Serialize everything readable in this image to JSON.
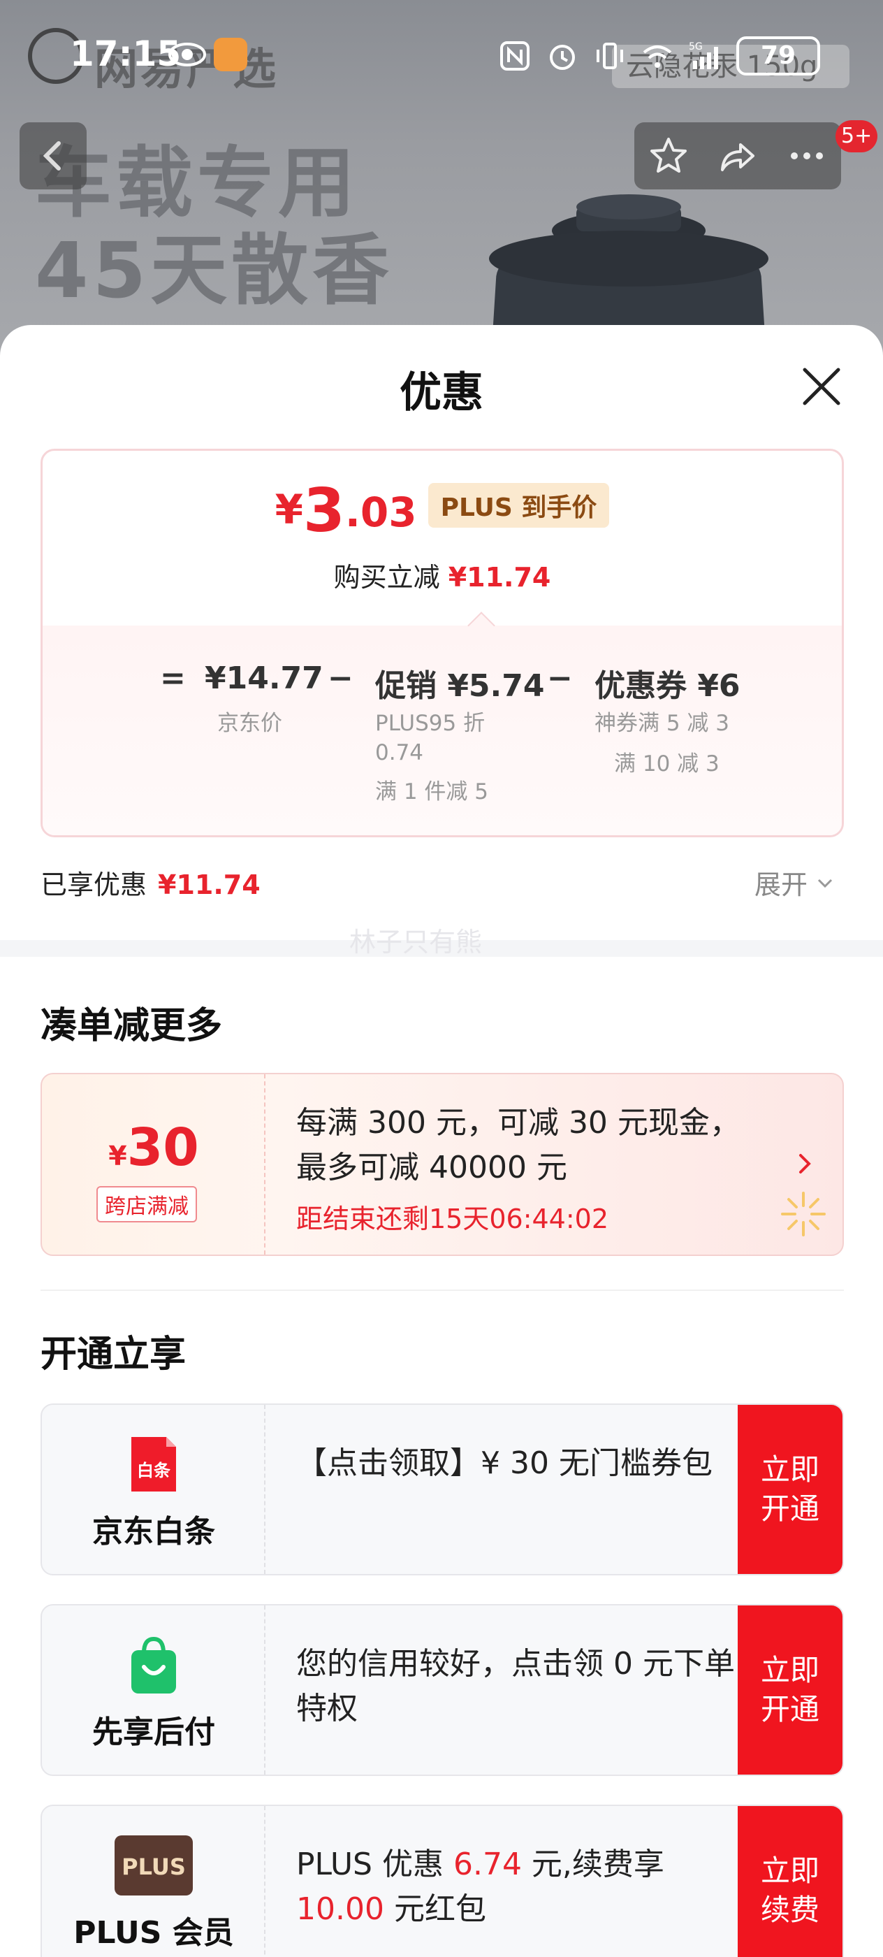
{
  "status_bar": {
    "time": "17:15",
    "battery": "79",
    "network": "5G"
  },
  "background": {
    "promo_line1": "车载专用",
    "promo_line2": "45天散香",
    "brand": "网易严选",
    "search_placeholder": "云隐花汞 150g",
    "notification_badge": "5+"
  },
  "sheet": {
    "title": "优惠",
    "price_summary": {
      "currency": "¥",
      "price_int": "3",
      "price_dec": ".03",
      "price_tag": "PLUS 到手价",
      "instant_label": "购买立减",
      "instant_amount": "¥11.74",
      "breakdown": {
        "equals": "=",
        "jd_price": "¥14.77",
        "jd_price_label": "京东价",
        "minus1": "−",
        "promo": "促销 ¥5.74",
        "promo_detail1": "PLUS95 折",
        "promo_detail2": "0.74",
        "promo_detail3": "满 1 件减 5",
        "minus2": "−",
        "coupon": "优惠券 ¥6",
        "coupon_detail1": "神券满 5 减 3",
        "coupon_detail2": "满 10 减 3"
      }
    },
    "saved_label": "已享优惠",
    "saved_amount": "¥11.74",
    "expand_label": "展开",
    "watermark": "林子只有熊"
  },
  "bundle_section": {
    "title": "凑单减更多",
    "coupon": {
      "currency": "¥",
      "amount": "30",
      "tag": "跨店满减",
      "line1": "每满 300 元，可减 30 元现金，",
      "line2": "最多可减 40000 元",
      "countdown": "距结束还剩15天06:44:02"
    }
  },
  "activate_section": {
    "title": "开通立享",
    "services": [
      {
        "name": "京东白条",
        "icon_label": "白条",
        "text": "【点击领取】¥ 30 无门槛券包",
        "button": "立即开通"
      },
      {
        "name": "先享后付",
        "text": "您的信用较好，点击领 0 元下单特权",
        "button": "立即开通"
      },
      {
        "name": "PLUS 会员",
        "icon_label": "PLUS",
        "text_a": "PLUS 优惠 ",
        "text_b": "6.74",
        "text_c": " 元,续费享",
        "text_d": "10.00",
        "text_e": " 元红包",
        "button": "立即续费"
      }
    ]
  },
  "colors": {
    "accent_red": "#e8232d",
    "button_red": "#f0151f",
    "plus_tag_bg": "#fbe9cf",
    "card_border": "#f6d5d8"
  }
}
